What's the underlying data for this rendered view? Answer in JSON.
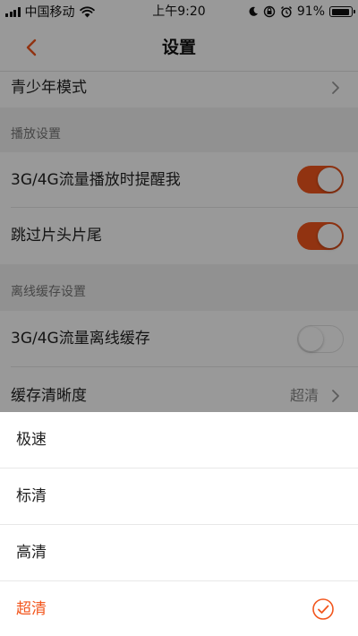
{
  "status_bar": {
    "carrier": "中国移动",
    "time": "上午9:20",
    "battery_percent": "91%",
    "battery_level": 0.91
  },
  "nav": {
    "title": "设置",
    "back_icon": "chevron-left-icon"
  },
  "rows": {
    "teen_mode": {
      "label": "青少年模式"
    },
    "playback_section": "播放设置",
    "cellular_play_reminder": {
      "label": "3G/4G流量播放时提醒我",
      "on": true
    },
    "skip_intro_outro": {
      "label": "跳过片头片尾",
      "on": true
    },
    "offline_section": "离线缓存设置",
    "cellular_offline_cache": {
      "label": "3G/4G流量离线缓存",
      "on": false
    },
    "cache_quality": {
      "label": "缓存清晰度",
      "value": "超清"
    }
  },
  "sheet": {
    "options": [
      "极速",
      "标清",
      "高清",
      "超清"
    ],
    "selected": "超清"
  },
  "colors": {
    "accent": "#f2561d",
    "overlay": "rgba(0,0,0,0.4)"
  }
}
